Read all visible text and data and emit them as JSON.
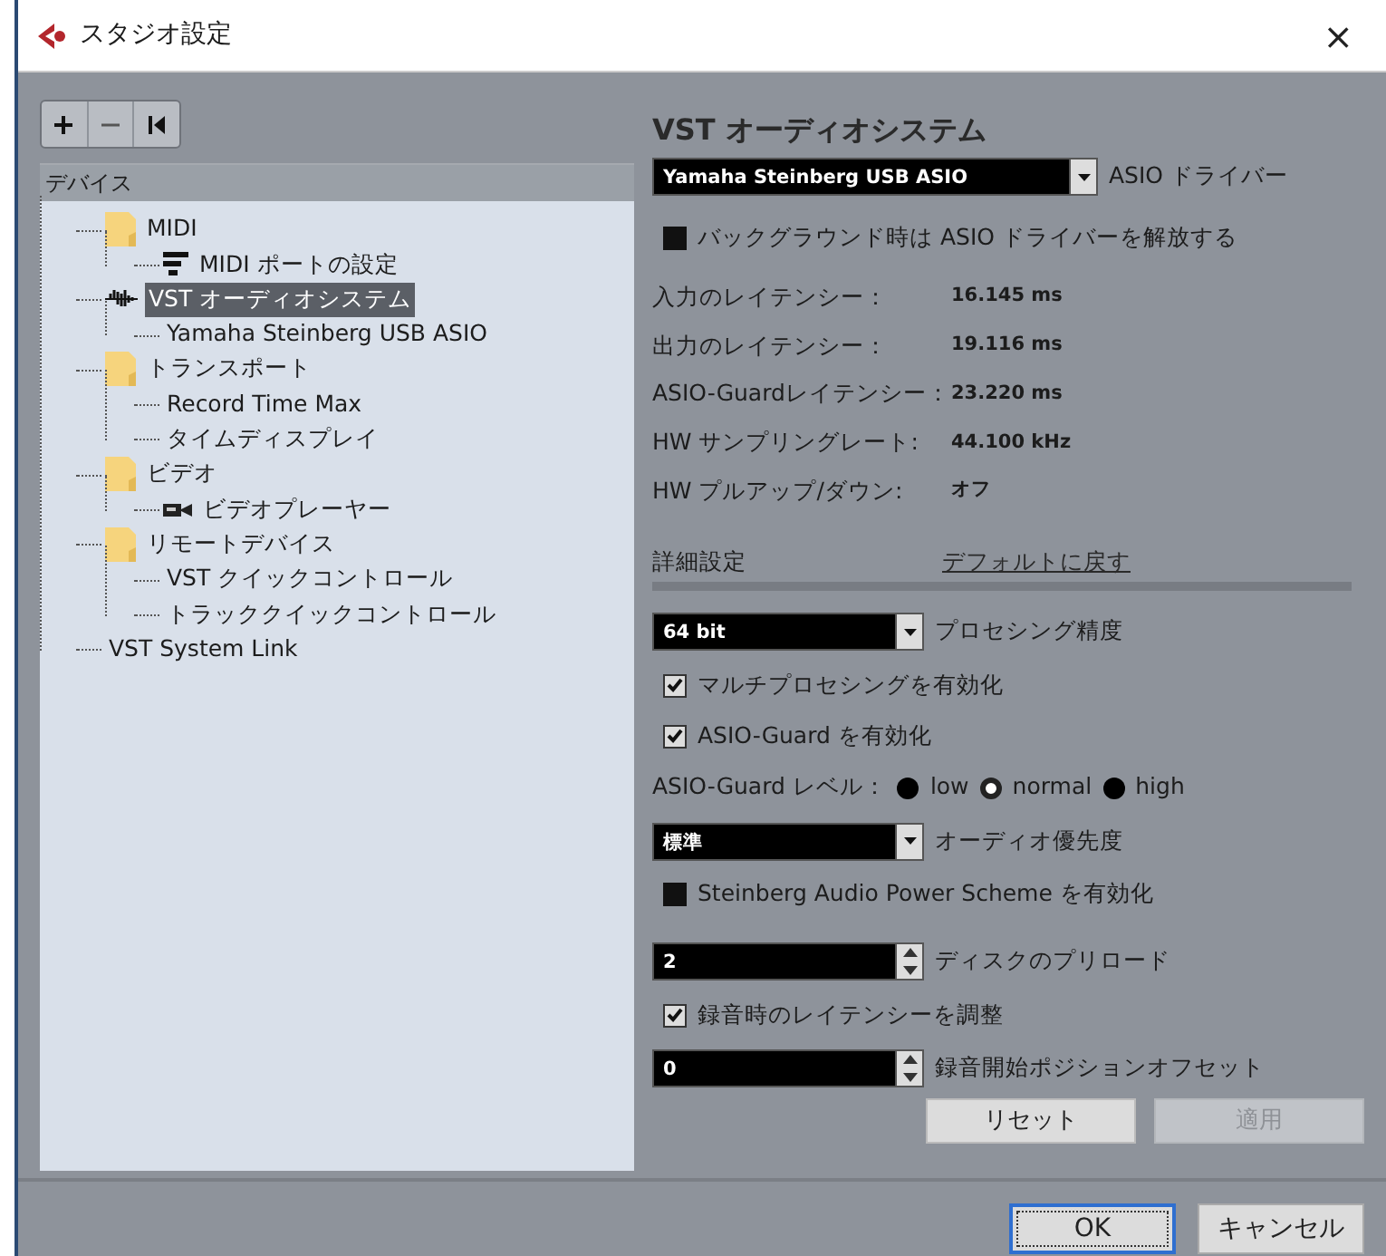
{
  "window": {
    "title": "スタジオ設定",
    "close": "×"
  },
  "tree": {
    "header": "デバイス",
    "items": [
      {
        "label": "MIDI",
        "kind": "folder",
        "selected": false,
        "children": [
          {
            "label": "MIDI ポートの設定",
            "kind": "midi",
            "selected": false
          }
        ]
      },
      {
        "label": "VST オーディオシステム",
        "kind": "audio",
        "selected": true,
        "children": [
          {
            "label": "Yamaha Steinberg USB ASIO",
            "kind": "plain",
            "selected": false
          }
        ]
      },
      {
        "label": "トランスポート",
        "kind": "folder",
        "selected": false,
        "children": [
          {
            "label": "Record Time Max",
            "kind": "plain",
            "selected": false
          },
          {
            "label": "タイムディスプレイ",
            "kind": "plain",
            "selected": false
          }
        ]
      },
      {
        "label": "ビデオ",
        "kind": "folder",
        "selected": false,
        "children": [
          {
            "label": "ビデオプレーヤー",
            "kind": "video",
            "selected": false
          }
        ]
      },
      {
        "label": "リモートデバイス",
        "kind": "folder",
        "selected": false,
        "children": [
          {
            "label": "VST クイックコントロール",
            "kind": "plain",
            "selected": false
          },
          {
            "label": "トラッククイックコントロール",
            "kind": "plain",
            "selected": false
          }
        ]
      },
      {
        "label": "VST System Link",
        "kind": "plain",
        "selected": false
      }
    ]
  },
  "panel": {
    "title": "VST オーディオシステム",
    "driver": {
      "value": "Yamaha Steinberg USB ASIO",
      "label": "ASIO ドライバー"
    },
    "release_option": {
      "label": "バックグラウンド時は ASIO ドライバーを解放する",
      "checked": false
    },
    "info": [
      {
        "label": "入力のレイテンシー：",
        "value": "16.145 ms"
      },
      {
        "label": "出力のレイテンシー：",
        "value": "19.116 ms"
      },
      {
        "label": "ASIO-Guardレイテンシー：",
        "value": "23.220 ms"
      },
      {
        "label": "HW サンプリングレート:",
        "value": "44.100 kHz"
      },
      {
        "label": "HW プルアップ/ダウン:",
        "value": "オフ"
      }
    ],
    "advanced_label": "詳細設定",
    "defaults_link": "デフォルトに戻す",
    "settings": [
      {
        "kind": "select",
        "option": "64 bit",
        "caption": "プロセシング精度"
      },
      {
        "kind": "checkbox",
        "checked": true,
        "label": "マルチプロセシングを有効化"
      },
      {
        "kind": "checkbox",
        "checked": true,
        "label": "ASIO-Guard を有効化"
      },
      {
        "kind": "radio",
        "label": "ASIO-Guard レベル：",
        "options": [
          {
            "label": "low",
            "selected": false
          },
          {
            "label": "normal",
            "selected": true
          },
          {
            "label": "high",
            "selected": false
          }
        ]
      },
      {
        "kind": "select",
        "option": "標準",
        "caption": "オーディオ優先度"
      },
      {
        "kind": "checkbox",
        "checked": false,
        "label": "Steinberg Audio Power Scheme を有効化"
      },
      {
        "kind": "spin",
        "value": "2",
        "label": "ディスクのプリロード"
      },
      {
        "kind": "checkbox",
        "checked": true,
        "label": "録音時のレイテンシーを調整"
      },
      {
        "kind": "spin",
        "value": "0",
        "label": "録音開始ポジションオフセット"
      }
    ],
    "buttons": [
      {
        "label": "リセット",
        "disabled": false
      },
      {
        "label": "適用",
        "disabled": true
      }
    ]
  },
  "footer_buttons": [
    {
      "label": "OK",
      "default": true
    },
    {
      "label": "キャンセル",
      "default": false
    }
  ]
}
